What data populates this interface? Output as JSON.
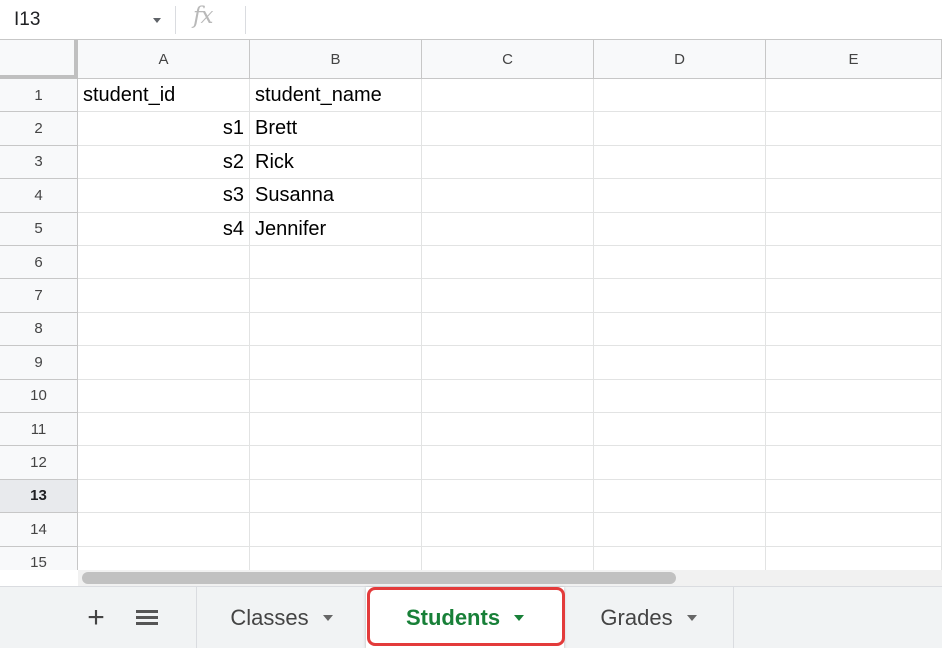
{
  "formula_bar": {
    "name_box": "I13",
    "fx_symbol": "fx",
    "formula_value": ""
  },
  "columns": [
    "A",
    "B",
    "C",
    "D",
    "E"
  ],
  "rows": [
    "1",
    "2",
    "3",
    "4",
    "5",
    "6",
    "7",
    "8",
    "9",
    "10",
    "11",
    "12",
    "13",
    "14",
    "15"
  ],
  "active_row": "13",
  "cells": {
    "A1": "student_id",
    "B1": "student_name",
    "A2": "s1",
    "B2": "Brett",
    "A3": "s2",
    "B3": "Rick",
    "A4": "s3",
    "B4": "Susanna",
    "A5": "s4",
    "B5": "Jennifer"
  },
  "sheet_bar": {
    "add_label": "+",
    "tabs": [
      {
        "label": "Classes",
        "active": false
      },
      {
        "label": "Students",
        "active": true
      },
      {
        "label": "Grades",
        "active": false
      }
    ]
  },
  "colors": {
    "active_tab_text": "#188038",
    "highlight_border": "#e33b3b"
  },
  "icons": {
    "add": "plus-icon",
    "all_sheets": "list-icon",
    "dropdown": "caret-down-icon"
  }
}
